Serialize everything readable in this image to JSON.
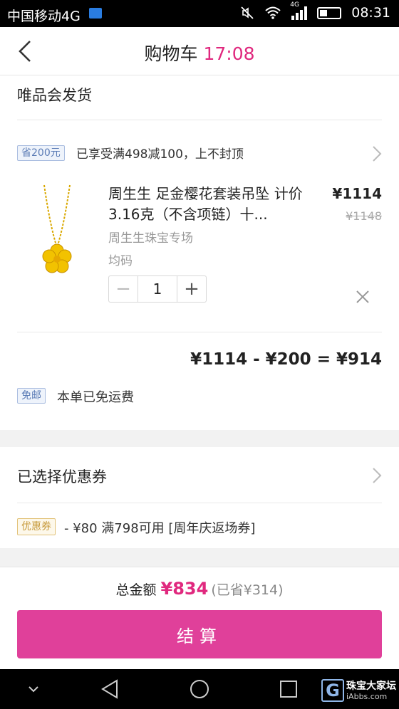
{
  "status_bar": {
    "carrier": "中国移动4G",
    "network": "4G",
    "time": "08:31"
  },
  "header": {
    "title": "购物车",
    "countdown": "17:08"
  },
  "vendor": {
    "name": "唯品会发货"
  },
  "promotion": {
    "tag": "省200元",
    "text": "已享受满498减100，上不封顶"
  },
  "product": {
    "name": "周生生 足金樱花套装吊坠 计价 3.16克（不含项链）十...",
    "store": "周生生珠宝专场",
    "size": "均码",
    "price": "¥1114",
    "original_price": "¥1148",
    "quantity": "1",
    "minus": "−",
    "plus": "+"
  },
  "calculation": "¥1114 - ¥200 = ¥914",
  "shipping": {
    "tag": "免邮",
    "text": "本单已免运费"
  },
  "coupon": {
    "title": "已选择优惠券",
    "tag": "优惠券",
    "text": "- ¥80 满798可用 [周年庆返场券]"
  },
  "footer": {
    "total_label": "总金额",
    "total_amount": "¥834",
    "saved": "(已省¥314)",
    "checkout_label": "结算"
  },
  "watermark": {
    "main": "珠宝大家坛",
    "sub": "iAbbs.com"
  },
  "colors": {
    "accent": "#e0287e",
    "checkout_button": "#e0409a",
    "gold": "#f2c200"
  }
}
